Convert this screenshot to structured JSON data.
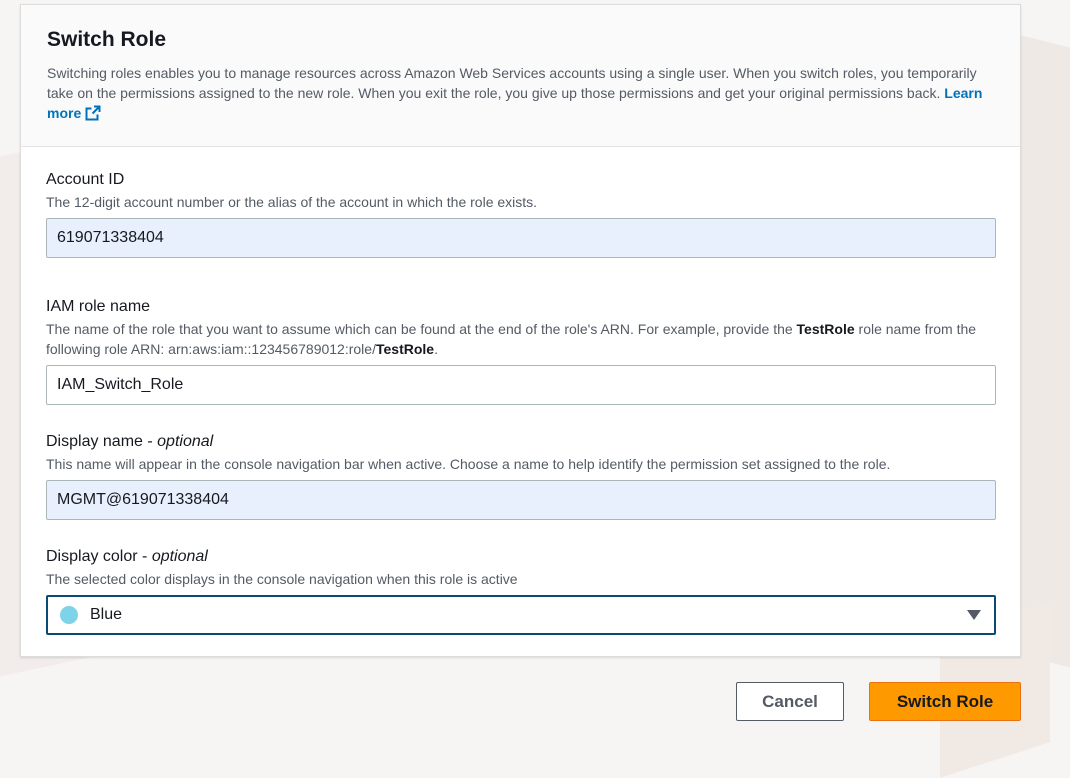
{
  "header": {
    "title": "Switch Role",
    "description": "Switching roles enables you to manage resources across Amazon Web Services accounts using a single user. When you switch roles, you temporarily take on the permissions assigned to the new role. When you exit the role, you give up those permissions and get your original permissions back.",
    "learn_more": "Learn more",
    "learn_more_icon": "external-link-icon"
  },
  "fields": {
    "account_id": {
      "label": "Account ID",
      "hint": "The 12-digit account number or the alias of the account in which the role exists.",
      "value": "619071338404"
    },
    "role_name": {
      "label": "IAM role name",
      "hint_before": "The name of the role that you want to assume which can be found at the end of the role's ARN. For example, provide the ",
      "hint_bold1": "TestRole",
      "hint_middle": " role name from the following role ARN: arn:aws:iam::123456789012:role/",
      "hint_bold2": "TestRole",
      "hint_end": ".",
      "value": "IAM_Switch_Role"
    },
    "display_name": {
      "label": "Display name - ",
      "label_optional": "optional",
      "hint": "This name will appear in the console navigation bar when active. Choose a name to help identify the permission set assigned to the role.",
      "value": "MGMT@619071338404"
    },
    "display_color": {
      "label": "Display color - ",
      "label_optional": "optional",
      "hint": "The selected color displays in the console navigation when this role is active",
      "value": "Blue",
      "swatch_color": "#7fd3e8"
    }
  },
  "actions": {
    "cancel": "Cancel",
    "submit": "Switch Role"
  },
  "colors": {
    "primary": "#ff9900",
    "link": "#0073bb",
    "focus_border": "#0a4a74",
    "autofill_bg": "#e8f0fe"
  }
}
